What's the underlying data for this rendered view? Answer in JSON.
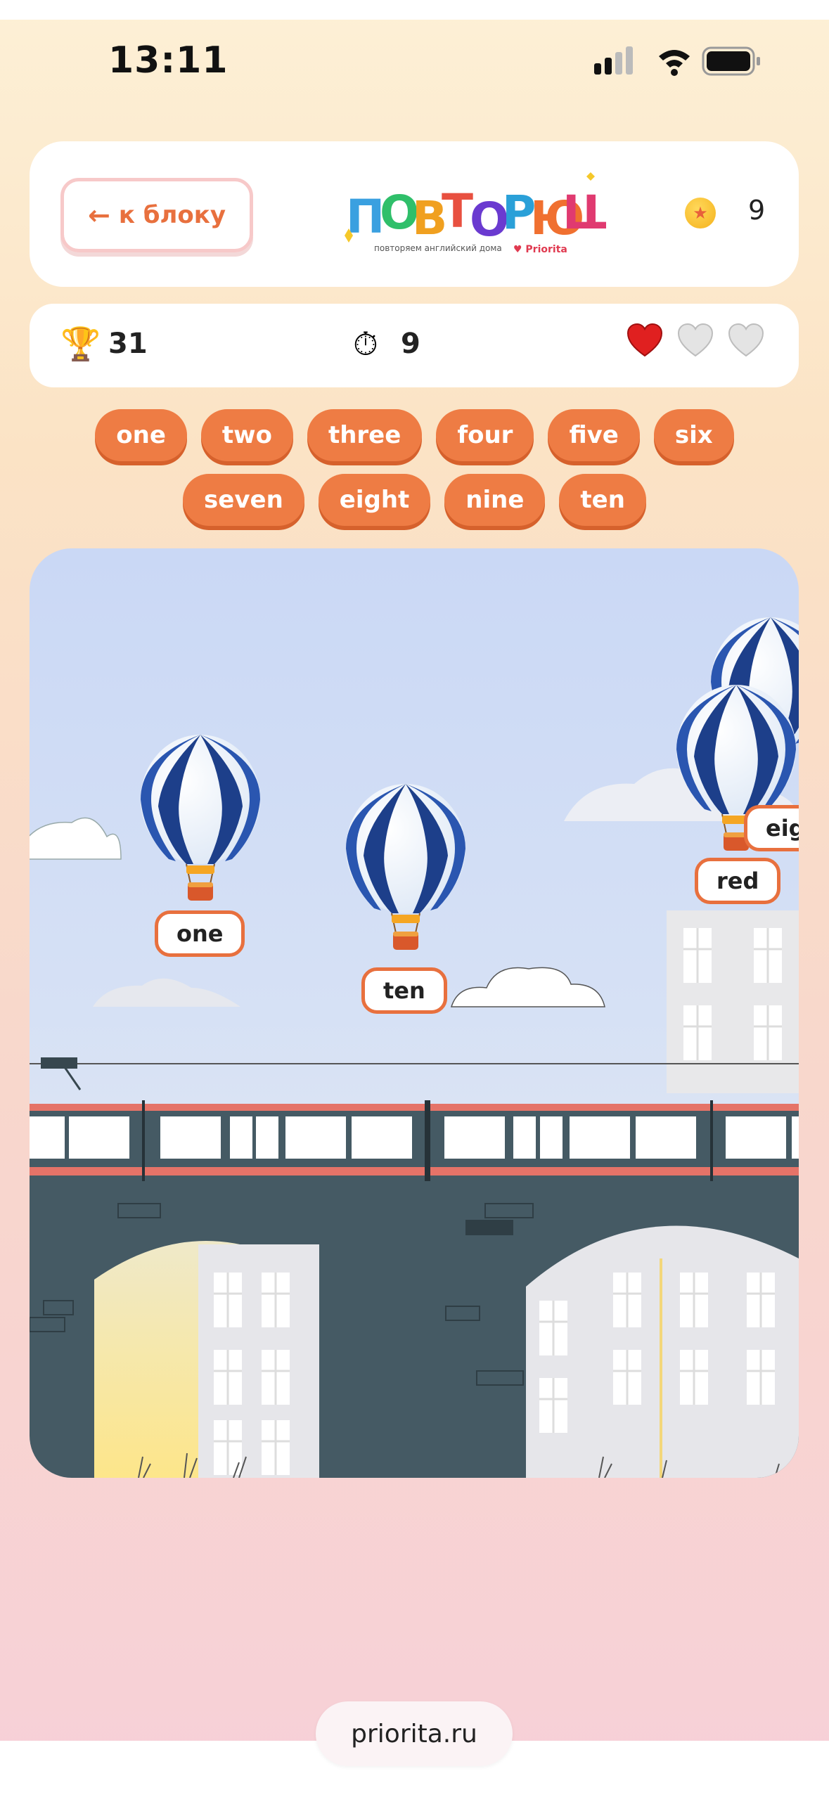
{
  "status_bar": {
    "time": "13:11"
  },
  "header": {
    "back_label": "к блоку",
    "logo_text": "ПОВТОРЮША",
    "coins": "9"
  },
  "stats": {
    "score": "31",
    "timer": "9",
    "lives_total": 3,
    "lives_remaining": 1
  },
  "word_chips": {
    "row1": [
      "one",
      "two",
      "three",
      "four",
      "five",
      "six"
    ],
    "row2": [
      "seven",
      "eight",
      "nine",
      "ten"
    ]
  },
  "balloons": [
    {
      "word": "one"
    },
    {
      "word": "ten"
    },
    {
      "word": "red"
    },
    {
      "word": "eig"
    }
  ],
  "footer": {
    "site": "priorita.ru"
  },
  "colors": {
    "accent": "#ee7c44",
    "accent_border": "#e8703e",
    "heart_active": "#e02020"
  }
}
